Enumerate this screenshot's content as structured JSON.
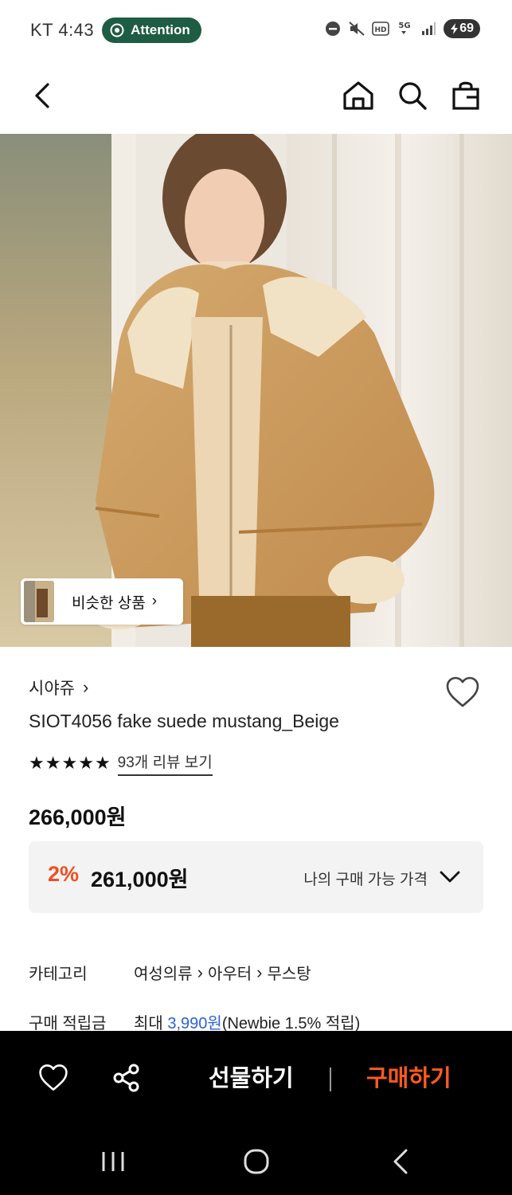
{
  "status_bar": {
    "carrier_time": "KT 4:43",
    "attention_label": "Attention",
    "hd_label": "HD",
    "network_label": "5G",
    "battery": "69"
  },
  "header": {
    "icons": [
      "back-icon",
      "home-icon",
      "search-icon",
      "shopping-bag-icon"
    ]
  },
  "hero": {
    "similar_label": "비슷한 상품",
    "similar_chevron": "›"
  },
  "product": {
    "brand": "시야쥬",
    "brand_chevron": "›",
    "name": "SIOT4056 fake suede mustang_Beige",
    "stars": 5,
    "review_link": "93개 리뷰 보기",
    "price": "266,000원"
  },
  "price_box": {
    "discount_pct": "2%",
    "discount_price": "261,000원",
    "my_price_label": "나의 구매 가능 가격"
  },
  "info": {
    "category_label": "카테고리",
    "category_path": [
      "여성의류",
      "아우터",
      "무스탕"
    ],
    "points_label": "구매 적립금",
    "points_prefix": "최대 ",
    "points_value": "3,990원",
    "points_suffix": "(Newbie 1.5% 적립)"
  },
  "action_bar": {
    "gift_label": "선물하기",
    "buy_label": "구매하기"
  },
  "colors": {
    "discount": "#f04e1f",
    "buy": "#ff5a1f",
    "link_blue": "#2a62d6",
    "attention_pill": "#1f5c44"
  }
}
